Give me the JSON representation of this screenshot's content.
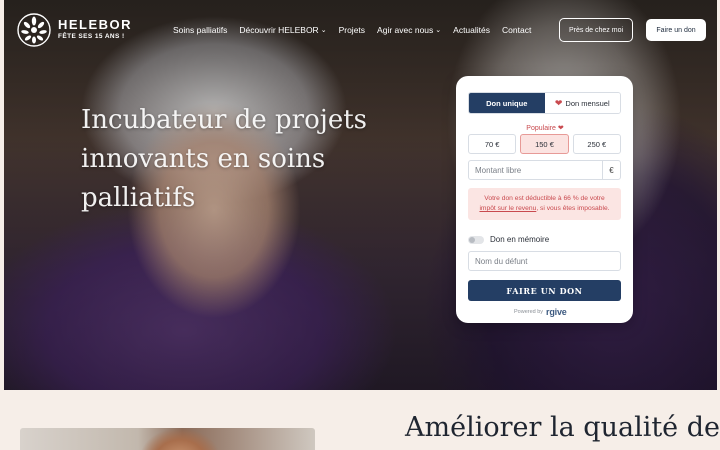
{
  "brand": {
    "name": "HELEBOR",
    "tagline": "FÊTE SES 15 ANS !",
    "logo_icon": "leaf-wreath-icon"
  },
  "nav": {
    "items": [
      {
        "label": "Soins palliatifs",
        "dropdown": false
      },
      {
        "label": "Découvrir HELEBOR",
        "dropdown": true
      },
      {
        "label": "Projets",
        "dropdown": false
      },
      {
        "label": "Agir avec nous",
        "dropdown": true
      },
      {
        "label": "Actualités",
        "dropdown": false
      },
      {
        "label": "Contact",
        "dropdown": false
      }
    ],
    "chevron_icon": "chevron-down-icon",
    "cta_outline": "Près de chez moi",
    "cta_primary": "Faire un don"
  },
  "hero": {
    "title_line1": "Incubateur de projets",
    "title_line2": "innovants en soins palliatifs"
  },
  "donation": {
    "frequency": {
      "single": "Don unique",
      "monthly": "Don mensuel",
      "active": "single",
      "monthly_icon": "heart-icon"
    },
    "popular_label": "Populaire",
    "amounts": [
      "70 €",
      "150 €",
      "250 €"
    ],
    "selected_amount": "150 €",
    "free_amount_placeholder": "Montant libre",
    "currency": "€",
    "tax_note": {
      "part1": "Votre don est déductible à 66 % de votre",
      "link": "impôt sur le revenu",
      "part2": ", si vous êtes imposable."
    },
    "memory_toggle": {
      "label": "Don en mémoire",
      "checked": false
    },
    "deceased_name_placeholder": "Nom du défunt",
    "submit_label": "FAIRE UN DON",
    "powered_by": "Powered by",
    "provider": "rgive"
  },
  "section2": {
    "title": "Améliorer la qualité de"
  },
  "colors": {
    "primary": "#243e64",
    "accent": "#c94a4f",
    "accent_bg": "#fbe5e3",
    "page_bg": "#f6eee8"
  }
}
